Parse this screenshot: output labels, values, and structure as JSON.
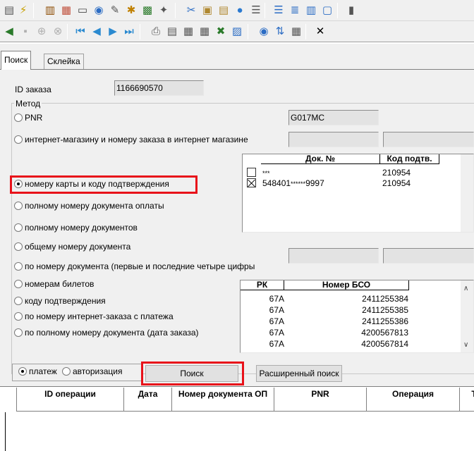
{
  "toolbar1": {
    "icons": [
      {
        "name": "document-icon",
        "glyph": "▤",
        "color": "#555555"
      },
      {
        "name": "lightning-icon",
        "glyph": "⚡",
        "color": "#c8a000"
      },
      {
        "name": "building-icon",
        "glyph": "▥",
        "color": "#8b4a00"
      },
      {
        "name": "calendar-icon",
        "glyph": "▦",
        "color": "#c0503c"
      },
      {
        "name": "card-icon",
        "glyph": "▭",
        "color": "#444444"
      },
      {
        "name": "globe-icon",
        "glyph": "◉",
        "color": "#2b6cc4"
      },
      {
        "name": "pencil-icon",
        "glyph": "✎",
        "color": "#555555"
      },
      {
        "name": "key-icon",
        "glyph": "✱",
        "color": "#c08000"
      },
      {
        "name": "book-icon",
        "glyph": "▩",
        "color": "#2a7a2a"
      },
      {
        "name": "person-icon",
        "glyph": "✦",
        "color": "#555555"
      },
      {
        "name": "scissors-icon",
        "glyph": "✂",
        "color": "#2b6cc4"
      },
      {
        "name": "copy-icon",
        "glyph": "▣",
        "color": "#b08830"
      },
      {
        "name": "paste-icon",
        "glyph": "▤",
        "color": "#b08830"
      },
      {
        "name": "info-icon",
        "glyph": "●",
        "color": "#2b7ad0"
      },
      {
        "name": "list-icon",
        "glyph": "☰",
        "color": "#555555"
      },
      {
        "name": "align-icon",
        "glyph": "☰",
        "color": "#2b6cc4"
      },
      {
        "name": "lines-icon",
        "glyph": "≣",
        "color": "#2b6cc4"
      },
      {
        "name": "columns-icon",
        "glyph": "▥",
        "color": "#2b6cc4"
      },
      {
        "name": "window-icon",
        "glyph": "▢",
        "color": "#2b6cc4"
      },
      {
        "name": "exit-icon",
        "glyph": "▮",
        "color": "#555555"
      }
    ]
  },
  "toolbar2": {
    "icons": [
      {
        "name": "back-icon",
        "glyph": "◀",
        "color": "#2a7a2a"
      },
      {
        "name": "save-icon",
        "glyph": "▪",
        "color": "#b0b0b0"
      },
      {
        "name": "add-icon",
        "glyph": "⊕",
        "color": "#b0b0b0"
      },
      {
        "name": "delete-icon",
        "glyph": "⊗",
        "color": "#b0b0b0"
      },
      {
        "name": "first-record-icon",
        "glyph": "⏮",
        "color": "#2b8ad0"
      },
      {
        "name": "prev-record-icon",
        "glyph": "◀",
        "color": "#2b8ad0"
      },
      {
        "name": "next-record-icon",
        "glyph": "▶",
        "color": "#2b8ad0"
      },
      {
        "name": "last-record-icon",
        "glyph": "⏭",
        "color": "#2b8ad0"
      },
      {
        "name": "print-icon",
        "glyph": "⎙",
        "color": "#555555"
      },
      {
        "name": "preview-icon",
        "glyph": "▤",
        "color": "#555555"
      },
      {
        "name": "export-icon",
        "glyph": "▦",
        "color": "#555555"
      },
      {
        "name": "export2-icon",
        "glyph": "▦",
        "color": "#555555"
      },
      {
        "name": "excel-icon",
        "glyph": "✖",
        "color": "#2a7a2a"
      },
      {
        "name": "report-icon",
        "glyph": "▨",
        "color": "#2b6cc4"
      },
      {
        "name": "search-icon",
        "glyph": "◉",
        "color": "#2b6cc4"
      },
      {
        "name": "sort-icon",
        "glyph": "⇅",
        "color": "#2b6cc4"
      },
      {
        "name": "calculator-icon",
        "glyph": "▦",
        "color": "#555555"
      },
      {
        "name": "close-icon",
        "glyph": "✕",
        "color": "#000000"
      }
    ]
  },
  "tabs": [
    {
      "label": "Поиск"
    },
    {
      "label": "Склейка"
    }
  ],
  "order_id": {
    "label": "ID заказа",
    "value": "1166690570"
  },
  "method": {
    "group_label": "Метод",
    "pnr_value": "G017MC",
    "options": [
      {
        "label": "PNR"
      },
      {
        "label": "интернет-магазину и номеру заказа в интернет магазине"
      },
      {
        "label": "номеру карты и коду подтверждения"
      },
      {
        "label": "полному номеру документа оплаты"
      },
      {
        "label": "полному номеру документов"
      },
      {
        "label": "общему номеру документа"
      },
      {
        "label": "по номеру документа (первые и последние четыре цифры"
      },
      {
        "label": "номерам билетов"
      },
      {
        "label": "коду подтверждения"
      },
      {
        "label": "по номеру интернет-заказа с платежа"
      },
      {
        "label": "по полному номеру документа (дата заказа)"
      }
    ],
    "selected_index": 2
  },
  "doc_grid": {
    "headers": [
      "Док. №",
      "Код подтв."
    ],
    "rows": [
      {
        "doc_prefix": "",
        "doc_stars": "***",
        "doc_suffix": "",
        "code": "210954",
        "checked": false
      },
      {
        "doc_prefix": "548401",
        "doc_stars": "******",
        "doc_suffix": "9997",
        "code": "210954",
        "checked": true
      }
    ]
  },
  "ticket_grid": {
    "headers": [
      "РК",
      "Номер БСО"
    ],
    "rows": [
      {
        "rk": "67А",
        "bso": "2411255384"
      },
      {
        "rk": "67А",
        "bso": "2411255385"
      },
      {
        "rk": "67А",
        "bso": "2411255386"
      },
      {
        "rk": "67А",
        "bso": "4200567813"
      },
      {
        "rk": "67А",
        "bso": "4200567814"
      }
    ]
  },
  "mode": {
    "options": [
      {
        "label": "платеж"
      },
      {
        "label": "авторизация"
      }
    ],
    "selected_index": 0
  },
  "buttons": {
    "search": "Поиск",
    "advanced_search": "Расширенный поиск"
  },
  "results_grid": {
    "headers": [
      "",
      "ID операции",
      "Дата",
      "Номер документа ОП",
      "PNR",
      "Операция",
      "Т"
    ]
  },
  "colors": {
    "highlight": "#e8121a",
    "panel": "#f0f0f0",
    "field": "#e3e3e3"
  }
}
